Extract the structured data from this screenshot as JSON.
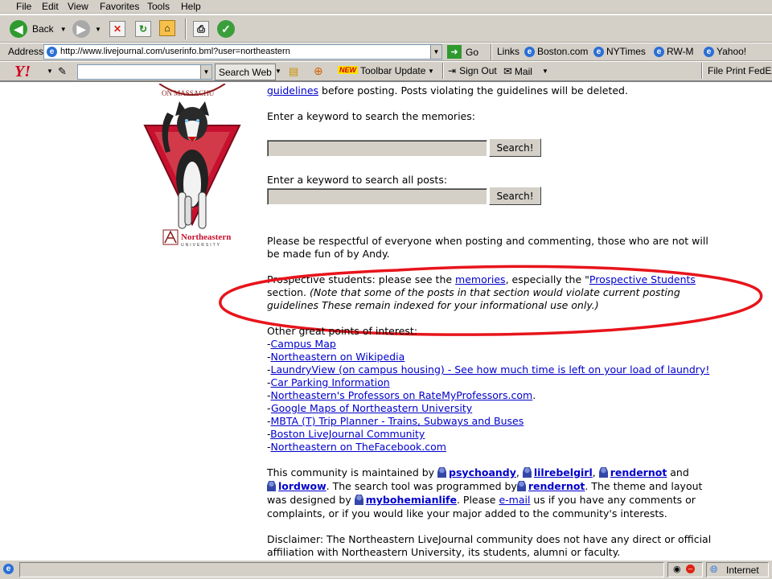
{
  "menu": [
    "File",
    "Edit",
    "View",
    "Favorites",
    "Tools",
    "Help"
  ],
  "toolbar": {
    "back_label": "Back"
  },
  "address": {
    "label": "Address",
    "url": "http://www.livejournal.com/userinfo.bml?user=northeastern",
    "go_label": "Go"
  },
  "links": {
    "label": "Links",
    "items": [
      "Boston.com",
      "NYTimes",
      "RW-M",
      "Yahoo!"
    ]
  },
  "yahoo": {
    "logo": "Y!",
    "search_label": "Search Web",
    "new_badge": "NEW",
    "update_label": "Toolbar Update",
    "signout_label": "Sign Out",
    "mail_label": "Mail",
    "fedex_label": "File Print FedEx Ki"
  },
  "logo": {
    "seal_text": "ON MASSACHU",
    "brand": "Northeastern",
    "brand_sub": "UNIVERSITY"
  },
  "content": {
    "guidelines_link": "guidelines",
    "guidelines_rest": " before posting. Posts violating the guidelines will be deleted.",
    "search_memories_label": "Enter a keyword to search the memories:",
    "search_all_label": "Enter a keyword to search all posts:",
    "search_button": "Search!",
    "respect_1": "Please be respectful of everyone when posting and commenting, those who are not will",
    "respect_2": "be made fun of by Andy.",
    "prospective_1": "Prospective students: please see the ",
    "memories_link": "memories",
    "prospective_2": ", especially the \"",
    "prospective_link": "Prospective Students",
    "prospective_3": "section. ",
    "note_1": "(Note that some of the posts in that section would violate current posting",
    "note_2": "guidelines These remain indexed for your informational use only.)",
    "other_label": "Other great points of interest:",
    "links": [
      "Campus Map",
      "Northeastern on Wikipedia",
      "LaundryView (on campus housing) - See how much time is left on your load of laundry!",
      "Car Parking Information",
      "Northeastern's Professors on RateMyProfessors.com",
      "Google Maps of Northeastern University",
      "MBTA (T) Trip Planner - Trains, Subways and Buses",
      "Boston LiveJournal Community",
      "Northeastern on TheFacebook.com"
    ],
    "maintained_1": "This community is maintained by ",
    "users": [
      "psychoandy",
      "lilrebelgirl",
      "rendernot",
      "lordwow",
      "rendernot",
      "mybohemianlife"
    ],
    "and": " and",
    "search_tool": ". The search tool was programmed by",
    "theme": ". The theme and layout",
    "designed": "was designed by ",
    "please": ". Please ",
    "email_link": "e-mail",
    "contact": " us if you have any comments or",
    "complaints": "complaints, or if you would like your major added to the community's interests.",
    "disclaimer_1": "Disclaimer: The Northeastern LiveJournal community does not have any direct or official",
    "disclaimer_2": "affiliation with Northeastern University, its students, alumni or faculty."
  },
  "status": {
    "zone": "Internet"
  },
  "colors": {
    "annotation": "#e8141b",
    "link": "#0000cc",
    "chrome": "#d4d0c8"
  }
}
